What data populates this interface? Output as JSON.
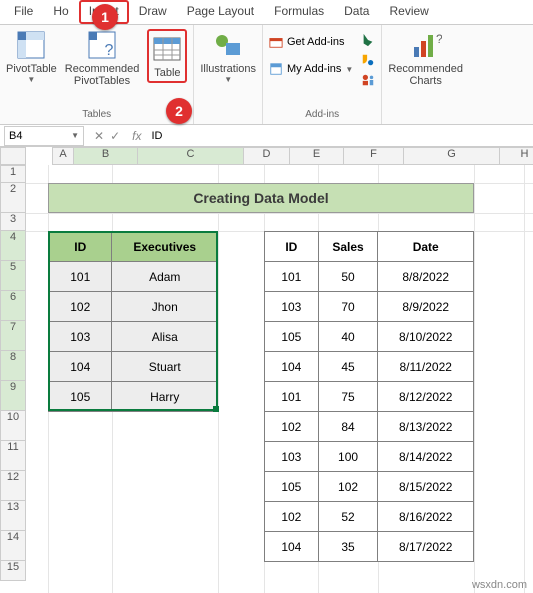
{
  "menu": {
    "file": "File",
    "home_partial": "Ho",
    "insert": "Insert",
    "draw": "Draw",
    "page_layout": "Page Layout",
    "formulas": "Formulas",
    "data": "Data",
    "review_partial": "Review"
  },
  "ribbon": {
    "tables_group_label": "Tables",
    "pivottable_label": "PivotTable",
    "recommended_pt_label": "Recommended\nPivotTables",
    "table_label": "Table",
    "illustrations_label": "Illustrations",
    "addins_group_label": "Add-ins",
    "get_addins_label": "Get Add-ins",
    "my_addins_label": "My Add-ins",
    "recommended_charts_label": "Recommended\nCharts"
  },
  "namebox": {
    "value": "B4"
  },
  "formula": {
    "value": "ID"
  },
  "columns": [
    "A",
    "B",
    "C",
    "D",
    "E",
    "F",
    "G",
    "H"
  ],
  "rows": [
    "1",
    "2",
    "3",
    "4",
    "5",
    "6",
    "7",
    "8",
    "9",
    "10",
    "11",
    "12",
    "13",
    "14",
    "15"
  ],
  "banner": {
    "title": "Creating Data Model"
  },
  "table_left": {
    "headers": [
      "ID",
      "Executives"
    ],
    "rows": [
      [
        "101",
        "Adam"
      ],
      [
        "102",
        "Jhon"
      ],
      [
        "103",
        "Alisa"
      ],
      [
        "104",
        "Stuart"
      ],
      [
        "105",
        "Harry"
      ]
    ]
  },
  "table_right": {
    "headers": [
      "ID",
      "Sales",
      "Date"
    ],
    "rows": [
      [
        "101",
        "50",
        "8/8/2022"
      ],
      [
        "103",
        "70",
        "8/9/2022"
      ],
      [
        "105",
        "40",
        "8/10/2022"
      ],
      [
        "104",
        "45",
        "8/11/2022"
      ],
      [
        "101",
        "75",
        "8/12/2022"
      ],
      [
        "102",
        "84",
        "8/13/2022"
      ],
      [
        "103",
        "100",
        "8/14/2022"
      ],
      [
        "105",
        "102",
        "8/15/2022"
      ],
      [
        "102",
        "52",
        "8/16/2022"
      ],
      [
        "104",
        "35",
        "8/17/2022"
      ]
    ]
  },
  "callouts": {
    "one": "1",
    "two": "2"
  },
  "watermark": "wsxdn.com"
}
